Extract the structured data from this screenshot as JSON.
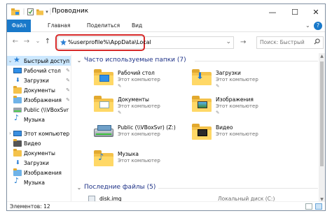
{
  "window": {
    "title": "Проводник",
    "controls": {
      "minimize": "—",
      "maximize": "☐",
      "close": "✕"
    }
  },
  "ribbon": {
    "tabs": [
      "Файл",
      "Главная",
      "Поделиться",
      "Вид"
    ],
    "expand": "⌄",
    "help": "?"
  },
  "nav": {
    "back": "←",
    "forward": "→",
    "recent": "⌄",
    "up": "↑",
    "address": "%userprofile%\\AppData\\Local",
    "go": "→",
    "search_placeholder": "Поиск: Быстрый"
  },
  "sidebar": {
    "items": [
      {
        "label": "Быстрый доступ",
        "icon": "star-icon",
        "pinned": false,
        "expander": "⌄",
        "selected": true
      },
      {
        "label": "Рабочий стол",
        "icon": "desktop-folder-icon",
        "pinned": true
      },
      {
        "label": "Загрузки",
        "icon": "downloads-icon",
        "pinned": true
      },
      {
        "label": "Документы",
        "icon": "documents-folder-icon",
        "pinned": true
      },
      {
        "label": "Изображения",
        "icon": "pictures-folder-icon",
        "pinned": true
      },
      {
        "label": "Public (\\\\VBoxSvr",
        "icon": "network-drive-icon",
        "pinned": false
      },
      {
        "label": "Музыка",
        "icon": "music-icon",
        "pinned": false
      },
      {
        "label": "Этот компьютер",
        "icon": "computer-icon",
        "pinned": false,
        "expander": "›"
      },
      {
        "label": "Видео",
        "icon": "videos-folder-icon",
        "pinned": false
      },
      {
        "label": "Документы",
        "icon": "documents-folder-icon",
        "pinned": false
      },
      {
        "label": "Загрузки",
        "icon": "downloads-icon",
        "pinned": false
      },
      {
        "label": "Изображения",
        "icon": "pictures-folder-icon",
        "pinned": false
      },
      {
        "label": "Музыка",
        "icon": "music-icon",
        "pinned": false
      }
    ],
    "pin_glyph": "📌"
  },
  "main": {
    "frequent_header": "Часто используемые папки (7)",
    "recent_header": "Последние файлы (5)",
    "folders": [
      {
        "name": "Рабочий стол",
        "sub": "Этот компьютер",
        "icon": "desktop-folder-icon",
        "pinned": true
      },
      {
        "name": "Загрузки",
        "sub": "Этот компьютер",
        "icon": "downloads-folder-icon",
        "pinned": true
      },
      {
        "name": "Документы",
        "sub": "Этот компьютер",
        "icon": "documents-folder-icon",
        "pinned": true
      },
      {
        "name": "Изображения",
        "sub": "Этот компьютер",
        "icon": "pictures-folder-icon",
        "pinned": true
      },
      {
        "name": "Public (\\\\VBoxSvr) (Z:)",
        "sub": "Этот компьютер",
        "icon": "network-drive-icon",
        "pinned": false
      },
      {
        "name": "Видео",
        "sub": "Этот компьютер",
        "icon": "videos-folder-icon",
        "pinned": false
      },
      {
        "name": "Музыка",
        "sub": "Этот компьютер",
        "icon": "music-folder-icon",
        "pinned": false
      }
    ],
    "recent_files": [
      {
        "name": "disk.img",
        "location": "Локальный диск (C:)"
      }
    ]
  },
  "status": {
    "text": "Элементов: 12"
  },
  "colors": {
    "accent": "#1979ca",
    "selection": "#cce8ff",
    "highlight_ring": "#d62828",
    "section_header": "#1e3287"
  }
}
